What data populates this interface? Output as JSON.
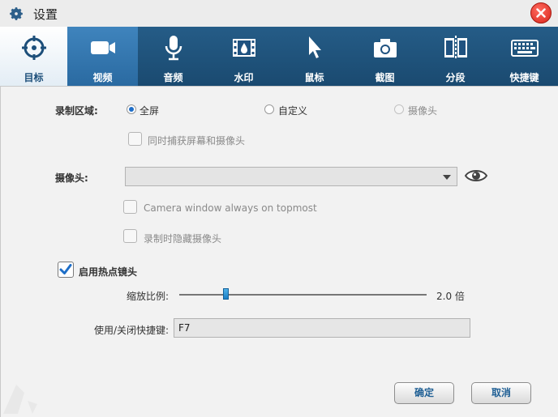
{
  "window": {
    "title": "设置"
  },
  "tabs": [
    {
      "id": "target",
      "label": "目标",
      "icon": "crosshair-icon"
    },
    {
      "id": "video",
      "label": "视频",
      "icon": "video-camera-icon"
    },
    {
      "id": "audio",
      "label": "音频",
      "icon": "microphone-icon"
    },
    {
      "id": "watermark",
      "label": "水印",
      "icon": "film-drop-icon"
    },
    {
      "id": "mouse",
      "label": "鼠标",
      "icon": "cursor-icon"
    },
    {
      "id": "screenshot",
      "label": "截图",
      "icon": "camera-icon"
    },
    {
      "id": "segment",
      "label": "分段",
      "icon": "segment-icon"
    },
    {
      "id": "hotkeys",
      "label": "快捷键",
      "icon": "keyboard-icon"
    }
  ],
  "recording_area": {
    "label": "录制区域:",
    "options": [
      {
        "label": "全屏",
        "selected": true,
        "enabled": true
      },
      {
        "label": "自定义",
        "selected": false,
        "enabled": true
      },
      {
        "label": "摄像头",
        "selected": false,
        "enabled": false
      }
    ],
    "capture_both_label": "同时捕获屏幕和摄像头"
  },
  "camera": {
    "label": "摄像头:",
    "selected_value": "",
    "topmost_label": "Camera window always on topmost",
    "hide_label": "录制时隐藏摄像头"
  },
  "hotspot": {
    "label": "启用热点镜头",
    "checked": true,
    "zoom_label": "缩放比例:",
    "zoom_value": "2.0 倍",
    "zoom_fraction": 0.19,
    "hotkey_label": "使用/关闭快捷键:",
    "hotkey_value": "F7"
  },
  "footer": {
    "ok_label": "确定",
    "cancel_label": "取消"
  },
  "colors": {
    "tabbar": "#1f5280",
    "selected_tab": "#3478b2",
    "accent_text": "#1f5f94",
    "close": "#e0352b"
  }
}
